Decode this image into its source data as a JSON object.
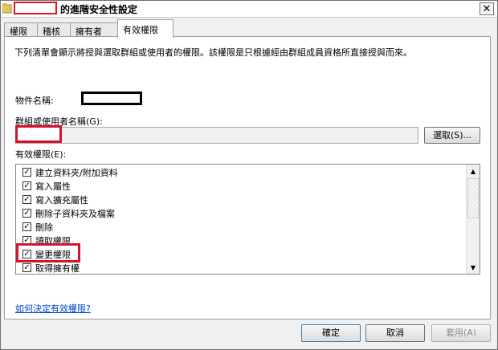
{
  "window": {
    "title": "的進階安全性設定",
    "close_glyph": "✕"
  },
  "tabs": [
    {
      "label": "權限"
    },
    {
      "label": "稽核"
    },
    {
      "label": "擁有者"
    },
    {
      "label": "有效權限"
    }
  ],
  "main": {
    "description": "下列清單會顯示將授與選取群組或使用者的權限。該權限是只根據經由群組成員資格所直接授與而來。",
    "object_name_label": "物件名稱:",
    "group_label": "群組或使用者名稱(G):",
    "select_button": "選取(S)...",
    "effective_label": "有效權限(E):",
    "permissions": [
      {
        "label": "建立資料夾/附加資料",
        "checked": true
      },
      {
        "label": "寫入屬性",
        "checked": true
      },
      {
        "label": "寫入擴充屬性",
        "checked": true
      },
      {
        "label": "刪除子資料夾及檔案",
        "checked": true
      },
      {
        "label": "刪除",
        "checked": true
      },
      {
        "label": "讀取權限",
        "checked": true
      },
      {
        "label": "變更權限",
        "checked": true
      },
      {
        "label": "取得擁有權",
        "checked": true
      }
    ],
    "help_link": "如何決定有效權限?"
  },
  "footer": {
    "ok": "確定",
    "cancel": "取消",
    "apply": "套用(A)"
  },
  "colors": {
    "highlight": "#d4132c",
    "link": "#0044cc"
  }
}
